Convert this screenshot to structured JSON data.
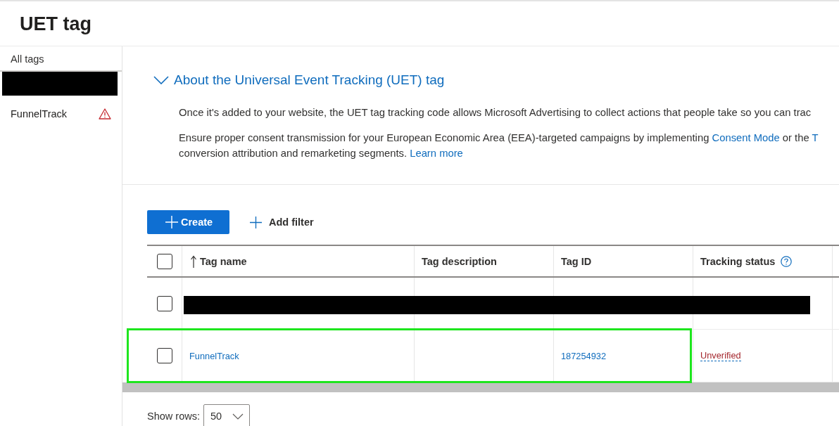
{
  "header": {
    "title": "UET tag"
  },
  "sidebar": {
    "heading": "All tags",
    "items": [
      {
        "kind": "redacted"
      },
      {
        "kind": "tag",
        "label": "FunnelTrack",
        "warning": true
      }
    ]
  },
  "about": {
    "title": "About the Universal Event Tracking (UET) tag",
    "expanded": true,
    "paragraphs": [
      {
        "lines": [
          [
            {
              "kind": "text",
              "text": "Once it's added to your website, the UET tag tracking code allows Microsoft Advertising to collect actions that people take so you can trac"
            }
          ]
        ]
      },
      {
        "lines": [
          [
            {
              "kind": "text",
              "text": "Ensure proper consent transmission for your European Economic Area (EEA)-targeted campaigns by implementing "
            },
            {
              "kind": "link",
              "text": "Consent Mode"
            },
            {
              "kind": "text",
              "text": " or the "
            },
            {
              "kind": "link",
              "text": "T"
            }
          ],
          [
            {
              "kind": "text",
              "text": "conversion attribution and remarketing segments. "
            },
            {
              "kind": "link",
              "text": "Learn more"
            }
          ]
        ]
      }
    ]
  },
  "toolbar": {
    "create_button": "Create",
    "add_filter_button": "Add filter"
  },
  "table": {
    "select_all_checked": false,
    "columns": [
      {
        "label": "Tag name",
        "sorted": true
      },
      {
        "label": "Tag description"
      },
      {
        "label": "Tag ID"
      },
      {
        "label": "Tracking status",
        "help": true
      }
    ],
    "rows": [
      {
        "kind": "redacted",
        "checked": false
      },
      {
        "kind": "tag",
        "checked": false,
        "highlighted": true,
        "tag_name": "FunnelTrack",
        "tag_id": "187254932",
        "tracking_status": "Unverified"
      }
    ]
  },
  "pagination": {
    "label": "Show rows:",
    "value": "50"
  }
}
